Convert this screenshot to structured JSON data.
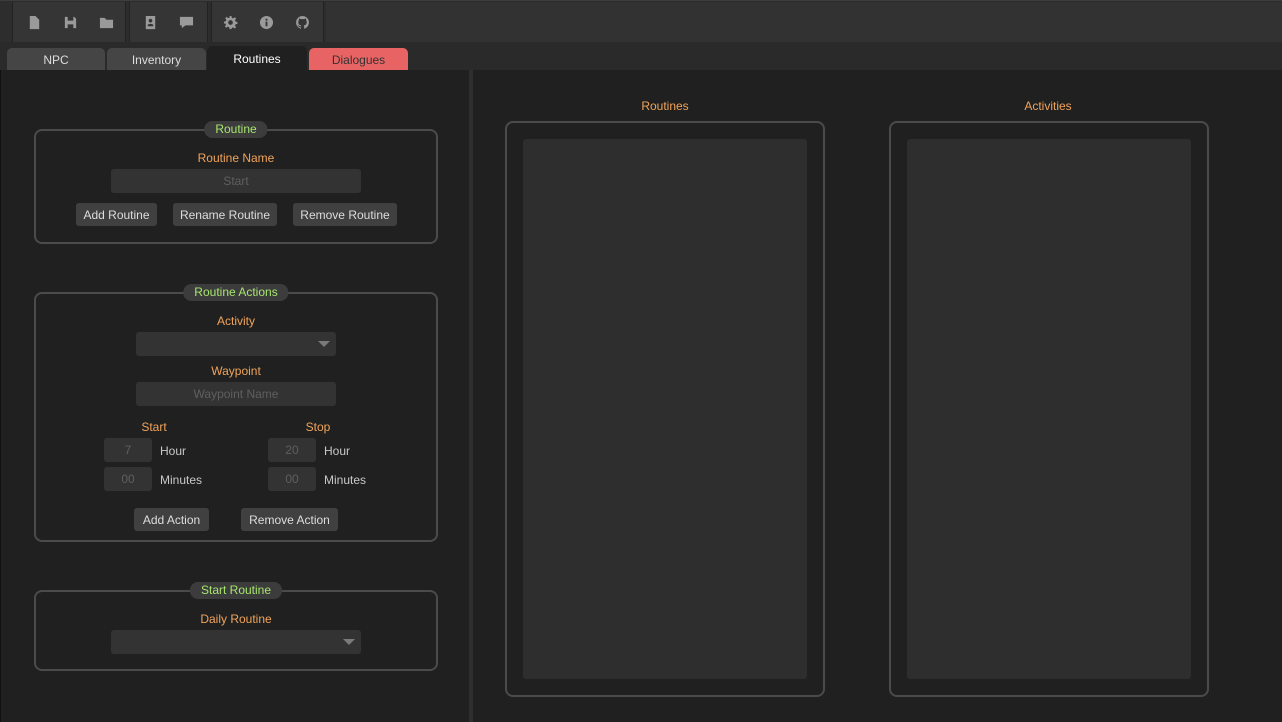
{
  "toolbar": {
    "groups": [
      [
        "new-file-icon",
        "save-icon",
        "open-folder-icon"
      ],
      [
        "contact-card-icon",
        "comment-icon"
      ],
      [
        "gear-icon",
        "info-icon",
        "github-icon"
      ]
    ]
  },
  "tabs": [
    {
      "label": "NPC",
      "state": "normal"
    },
    {
      "label": "Inventory",
      "state": "normal"
    },
    {
      "label": "Routines",
      "state": "active"
    },
    {
      "label": "Dialogues",
      "state": "highlighted"
    }
  ],
  "routine_group": {
    "title": "Routine",
    "name_label": "Routine Name",
    "name_placeholder": "Start",
    "add_label": "Add Routine",
    "rename_label": "Rename Routine",
    "remove_label": "Remove Routine"
  },
  "actions_group": {
    "title": "Routine Actions",
    "activity_label": "Activity",
    "activity_value": "",
    "waypoint_label": "Waypoint",
    "waypoint_placeholder": "Waypoint Name",
    "start_label": "Start",
    "stop_label": "Stop",
    "start_hour_placeholder": "7",
    "start_minutes_placeholder": "00",
    "stop_hour_placeholder": "20",
    "stop_minutes_placeholder": "00",
    "hour_label": "Hour",
    "minutes_label": "Minutes",
    "add_label": "Add Action",
    "remove_label": "Remove Action"
  },
  "start_group": {
    "title": "Start Routine",
    "daily_label": "Daily Routine",
    "daily_value": ""
  },
  "routines_list": {
    "title": "Routines",
    "items": []
  },
  "activities_list": {
    "title": "Activities",
    "items": []
  },
  "colors": {
    "background": "#202020",
    "accent_orange": "#f0a45a",
    "group_title_green": "#a6e56f",
    "dialogues_tab": "#e86464"
  }
}
